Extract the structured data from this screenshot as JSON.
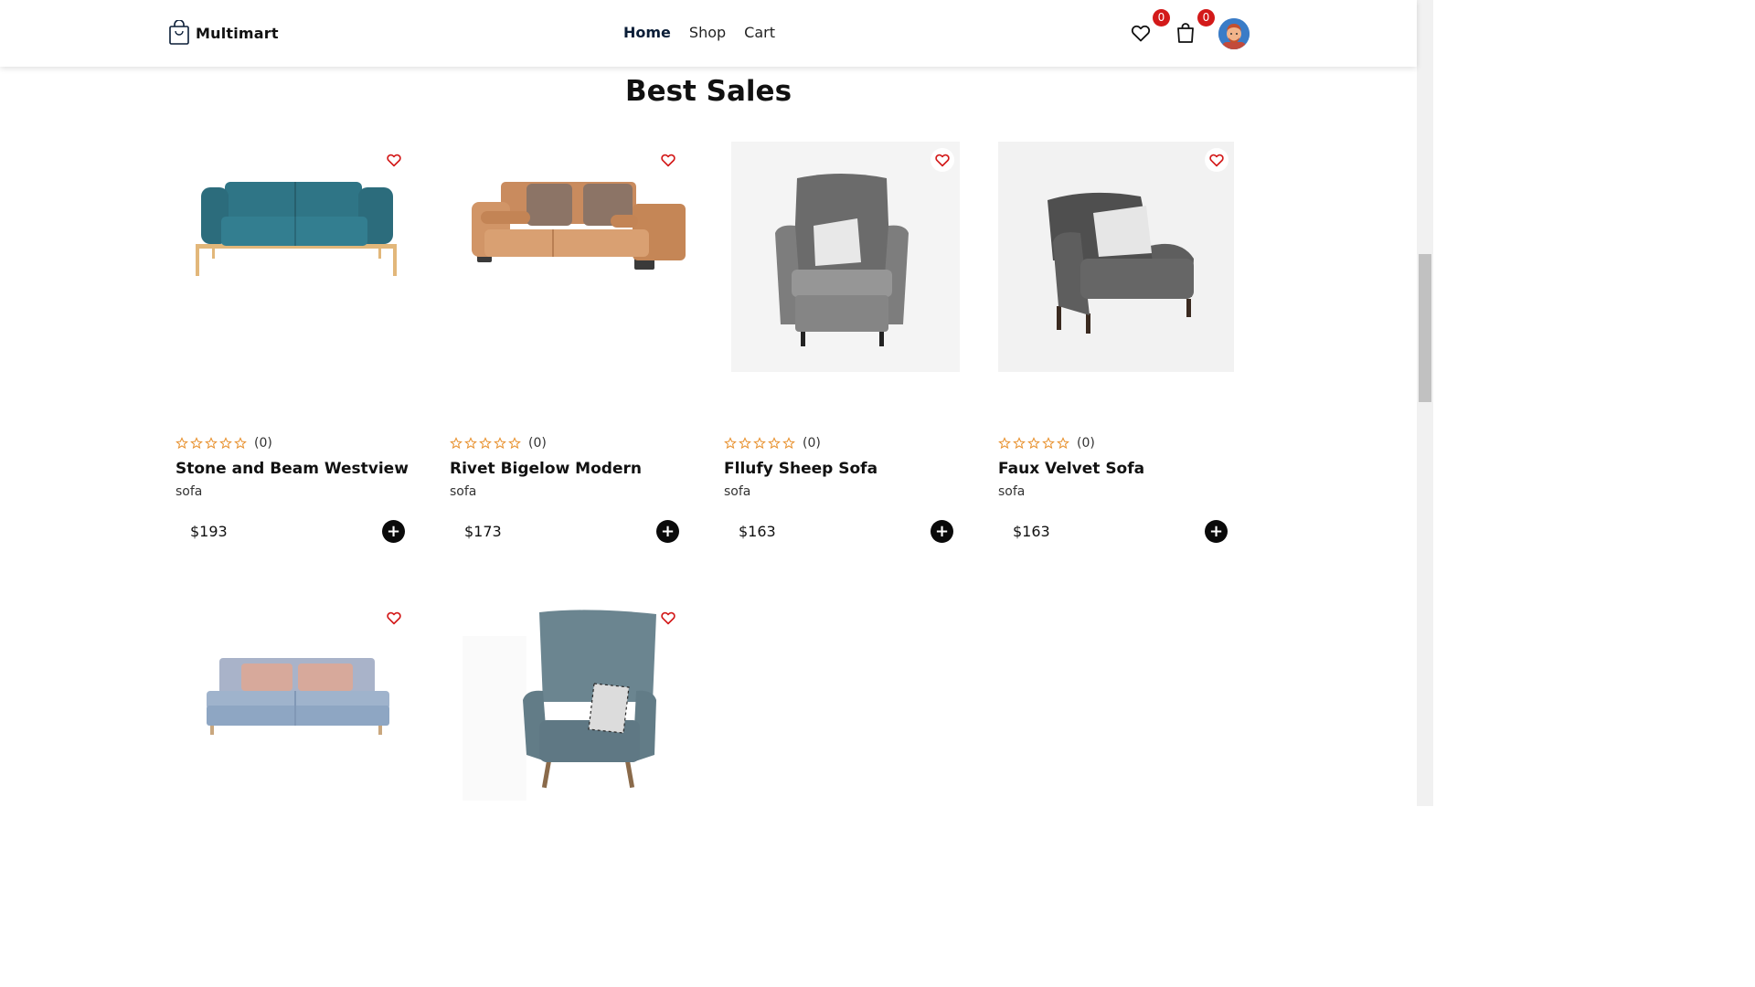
{
  "brand": {
    "name": "Multimart",
    "logo_icon": "shopping-bag-icon"
  },
  "nav": {
    "home": "Home",
    "shop": "Shop",
    "cart": "Cart"
  },
  "header_icons": {
    "wishlist_count": "0",
    "cart_count": "0"
  },
  "section": {
    "title": "Best Sales"
  },
  "colors": {
    "badge": "#d31919",
    "star": "#e8912e",
    "heart": "#d31919",
    "add_button": "#0a0a0a"
  },
  "products": [
    {
      "name": "Stone and Beam Westview",
      "category": "sofa",
      "price": "$193",
      "rating_count": "(0)",
      "stars": 0,
      "image": "teal-sofa"
    },
    {
      "name": "Rivet Bigelow Modern",
      "category": "sofa",
      "price": "$173",
      "rating_count": "(0)",
      "stars": 0,
      "image": "tan-leather-sofa"
    },
    {
      "name": "Fllufy Sheep Sofa",
      "category": "sofa",
      "price": "$163",
      "rating_count": "(0)",
      "stars": 0,
      "image": "grey-wingback-chair"
    },
    {
      "name": "Faux Velvet Sofa",
      "category": "sofa",
      "price": "$163",
      "rating_count": "(0)",
      "stars": 0,
      "image": "dark-grey-armchair"
    },
    {
      "image": "pastel-blue-sofa"
    },
    {
      "image": "blue-highback-chair"
    }
  ]
}
